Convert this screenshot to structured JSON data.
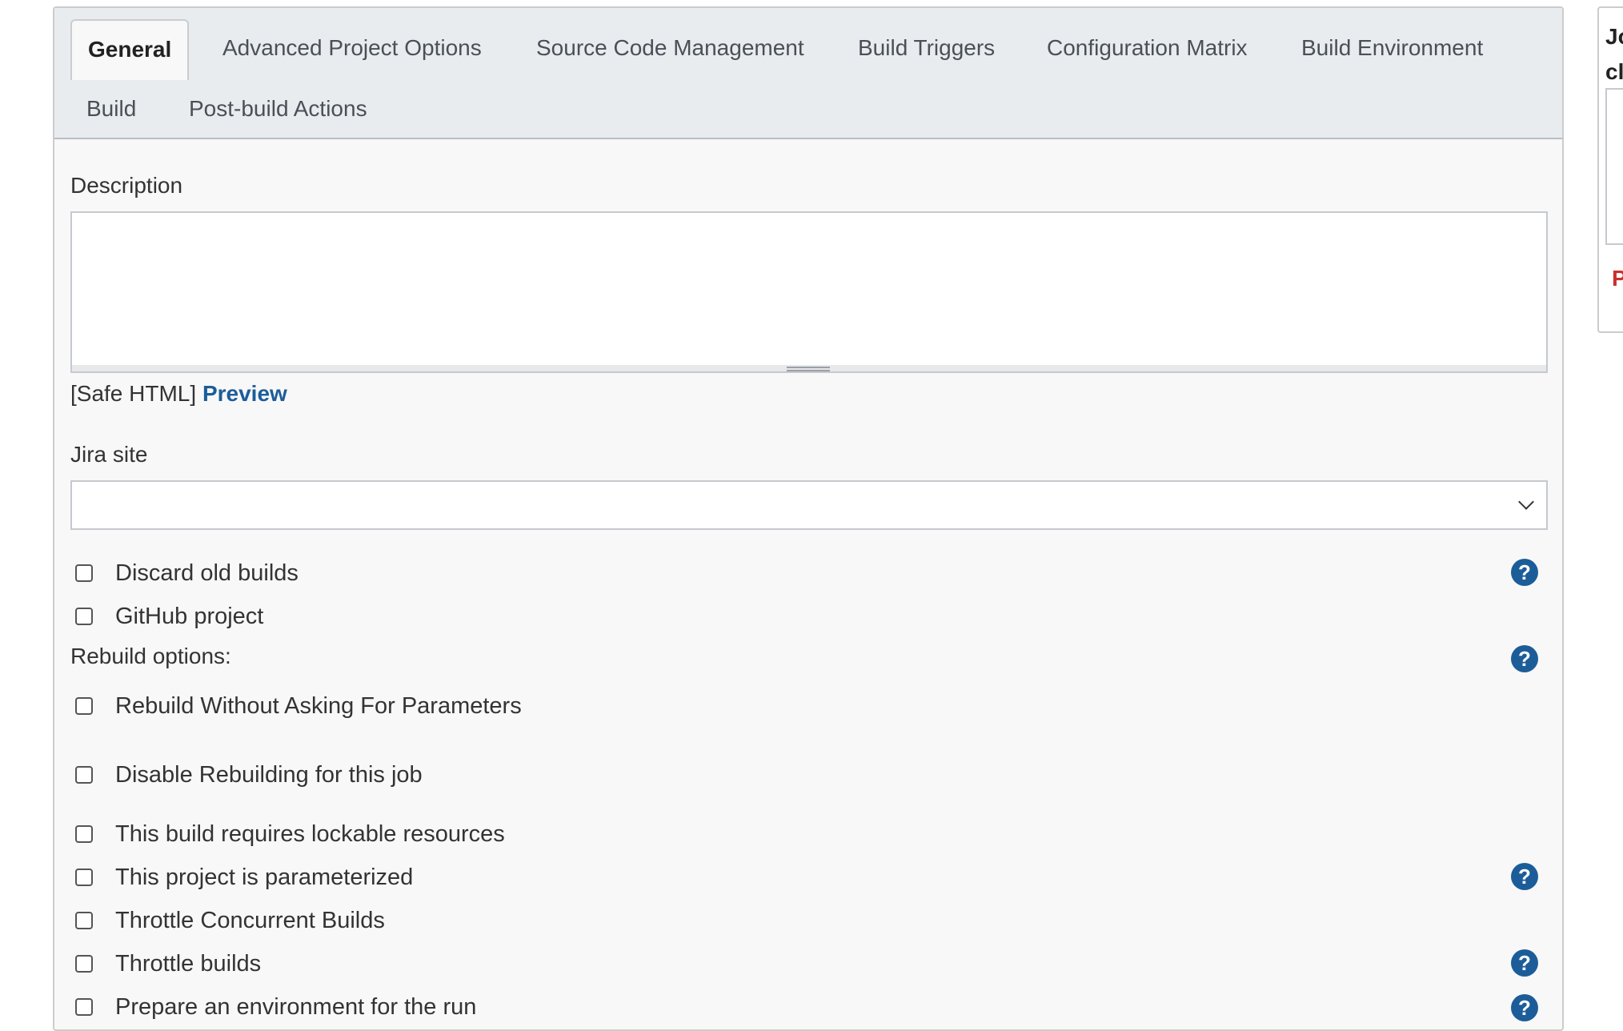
{
  "tabs": [
    {
      "label": "General",
      "active": true
    },
    {
      "label": "Advanced Project Options",
      "active": false
    },
    {
      "label": "Source Code Management",
      "active": false
    },
    {
      "label": "Build Triggers",
      "active": false
    },
    {
      "label": "Configuration Matrix",
      "active": false
    },
    {
      "label": "Build Environment",
      "active": false
    },
    {
      "label": "Build",
      "active": false
    },
    {
      "label": "Post-build Actions",
      "active": false
    }
  ],
  "description": {
    "label": "Description",
    "value": "",
    "safe_html": "[Safe HTML]",
    "preview_link": "Preview"
  },
  "jira": {
    "label": "Jira site",
    "selected": ""
  },
  "options": {
    "discard_old_builds": "Discard old builds",
    "github_project": "GitHub project",
    "rebuild_options_heading": "Rebuild options:",
    "rebuild_without_asking": "Rebuild Without Asking For Parameters",
    "disable_rebuilding": "Disable Rebuilding for this job",
    "lockable_resources": "This build requires lockable resources",
    "parameterized": "This project is parameterized",
    "throttle_concurrent": "Throttle Concurrent Builds",
    "throttle_builds": "Throttle builds",
    "prepare_environment": "Prepare an environment for the run"
  },
  "help_glyph": "?",
  "right_panel": {
    "title_line1": "Jo",
    "title_line2": "cl",
    "red_text": "P"
  },
  "colors": {
    "link": "#1c5d99",
    "help_icon": "#1c5d99",
    "tab_bar": "#e9ecef",
    "error": "#c9302c"
  }
}
